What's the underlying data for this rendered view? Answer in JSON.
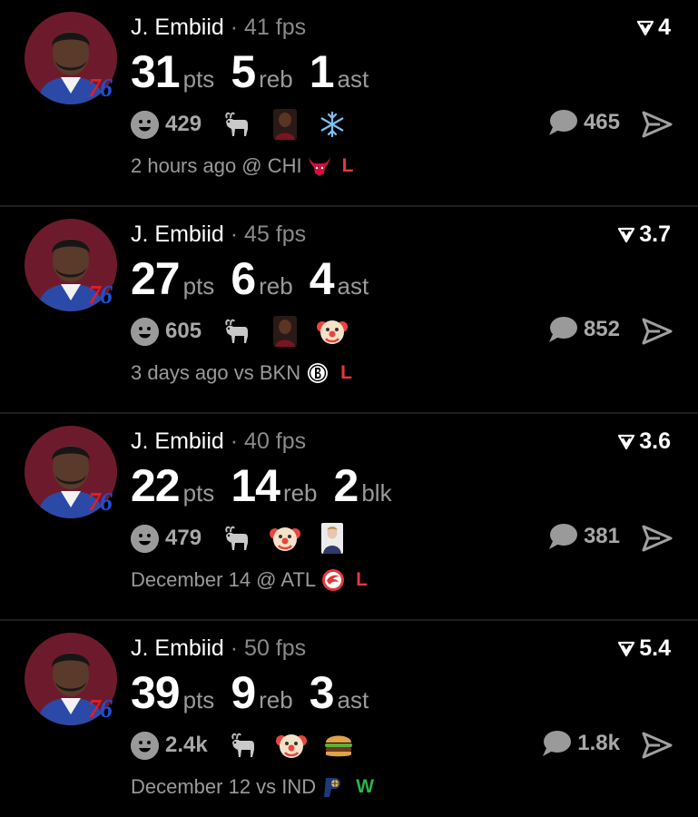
{
  "posts": [
    {
      "player": "J. Embiid",
      "separator": "·",
      "fps": "41 fps",
      "rating": "4",
      "stats": [
        {
          "value": "31",
          "unit": "pts"
        },
        {
          "value": "5",
          "unit": "reb"
        },
        {
          "value": "1",
          "unit": "ast"
        }
      ],
      "reaction_count": "429",
      "reaction_icons": [
        "goat-icon",
        "player-photo-icon",
        "snowflake-icon"
      ],
      "comment_count": "465",
      "game_info": "2 hours ago @ CHI",
      "opponent_logo": "bulls-logo-icon",
      "result": "L"
    },
    {
      "player": "J. Embiid",
      "separator": "·",
      "fps": "45 fps",
      "rating": "3.7",
      "stats": [
        {
          "value": "27",
          "unit": "pts"
        },
        {
          "value": "6",
          "unit": "reb"
        },
        {
          "value": "4",
          "unit": "ast"
        }
      ],
      "reaction_count": "605",
      "reaction_icons": [
        "goat-icon",
        "player-photo-icon",
        "clown-icon"
      ],
      "comment_count": "852",
      "game_info": "3 days ago vs BKN",
      "opponent_logo": "nets-logo-icon",
      "result": "L"
    },
    {
      "player": "J. Embiid",
      "separator": "·",
      "fps": "40 fps",
      "rating": "3.6",
      "stats": [
        {
          "value": "22",
          "unit": "pts"
        },
        {
          "value": "14",
          "unit": "reb"
        },
        {
          "value": "2",
          "unit": "blk"
        }
      ],
      "reaction_count": "479",
      "reaction_icons": [
        "goat-icon",
        "clown-icon",
        "fan-photo-icon"
      ],
      "comment_count": "381",
      "game_info": "December 14 @ ATL",
      "opponent_logo": "hawks-logo-icon",
      "result": "L"
    },
    {
      "player": "J. Embiid",
      "separator": "·",
      "fps": "50 fps",
      "rating": "5.4",
      "stats": [
        {
          "value": "39",
          "unit": "pts"
        },
        {
          "value": "9",
          "unit": "reb"
        },
        {
          "value": "3",
          "unit": "ast"
        }
      ],
      "reaction_count": "2.4k",
      "reaction_icons": [
        "goat-icon",
        "clown-icon",
        "burger-icon"
      ],
      "comment_count": "1.8k",
      "game_info": "December 12 vs IND",
      "opponent_logo": "pacers-logo-icon",
      "result": "W"
    }
  ],
  "team_badge": "76",
  "colors": {
    "background": "#000000",
    "muted_text": "#9a9a9a",
    "loss": "#e5383b",
    "win": "#2fb24a",
    "avatar_bg": "#6d1b2c"
  }
}
